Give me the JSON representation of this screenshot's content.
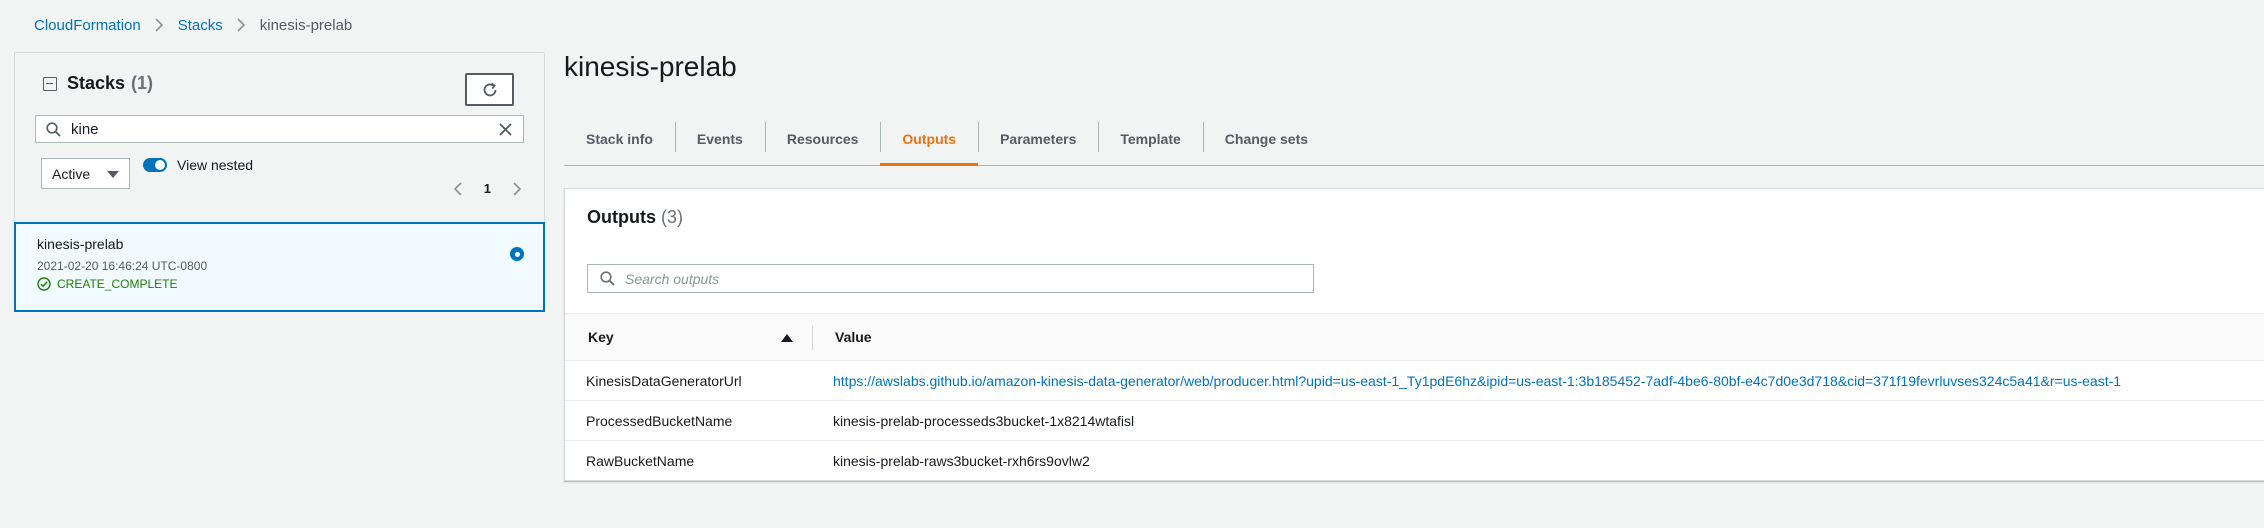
{
  "breadcrumb": {
    "items": [
      "CloudFormation",
      "Stacks"
    ],
    "current": "kinesis-prelab"
  },
  "left_panel": {
    "title": "Stacks",
    "count": "(1)",
    "search_value": "kine",
    "filter_select": "Active",
    "toggle_label": "View nested",
    "page_number": "1",
    "stack": {
      "name": "kinesis-prelab",
      "date": "2021-02-20 16:46:24 UTC-0800",
      "status": "CREATE_COMPLETE"
    }
  },
  "main": {
    "title": "kinesis-prelab",
    "tabs": [
      {
        "label": "Stack info"
      },
      {
        "label": "Events"
      },
      {
        "label": "Resources"
      },
      {
        "label": "Outputs"
      },
      {
        "label": "Parameters"
      },
      {
        "label": "Template"
      },
      {
        "label": "Change sets"
      }
    ],
    "active_tab": "Outputs",
    "outputs": {
      "title": "Outputs",
      "count": "(3)",
      "search_placeholder": "Search outputs",
      "columns": {
        "key": "Key",
        "value": "Value"
      },
      "rows": [
        {
          "key": "KinesisDataGeneratorUrl",
          "value": "https://awslabs.github.io/amazon-kinesis-data-generator/web/producer.html?upid=us-east-1_Ty1pdE6hz&ipid=us-east-1:3b185452-7adf-4be6-80bf-e4c7d0e3d718&cid=371f19fevrluvses324c5a41&r=us-east-1"
        },
        {
          "key": "ProcessedBucketName",
          "value": "kinesis-prelab-processeds3bucket-1x8214wtafisl"
        },
        {
          "key": "RawBucketName",
          "value": "kinesis-prelab-raws3bucket-rxh6rs9ovlw2"
        }
      ]
    }
  },
  "icons": [
    "chevron-right-icon",
    "refresh-icon",
    "search-icon",
    "close-icon",
    "chevron-left-icon",
    "check-circle-icon",
    "sort-up-icon"
  ],
  "colors": {
    "link": "#0073bb",
    "active_tab": "#ec7211",
    "success": "#1d8102",
    "selected_bg": "#f1faff"
  }
}
